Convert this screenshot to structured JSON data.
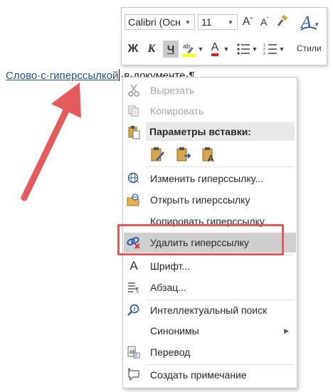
{
  "document": {
    "link_text": "Слово·с·гиперссылкой",
    "rest_text": "·в·документе·¶"
  },
  "toolbar": {
    "font_name": "Calibri (Осн",
    "font_size": "11",
    "grow_font": "A",
    "shrink_font": "A",
    "bold": "Ж",
    "italic": "К",
    "underline": "Ч",
    "font_color_letter": "A",
    "styles_label": "Стили"
  },
  "menu": {
    "cut": "Вырезать",
    "copy": "Копировать",
    "paste_options": "Параметры вставки:",
    "edit_link": "Изменить гиперссылку...",
    "open_link": "Открыть гиперссылку",
    "copy_link": "Копировать гиперссылку",
    "remove_link": "Удалить гиперссылку",
    "font": "Шрифт...",
    "paragraph": "Абзац...",
    "smart_lookup": "Интеллектуальный поиск",
    "synonyms": "Синонимы",
    "translate": "Перевод",
    "new_comment": "Создать примечание"
  },
  "colors": {
    "accent_red": "#e55b5b",
    "link_blue": "#1f4e92",
    "hover_gray": "#cfcfcf"
  }
}
